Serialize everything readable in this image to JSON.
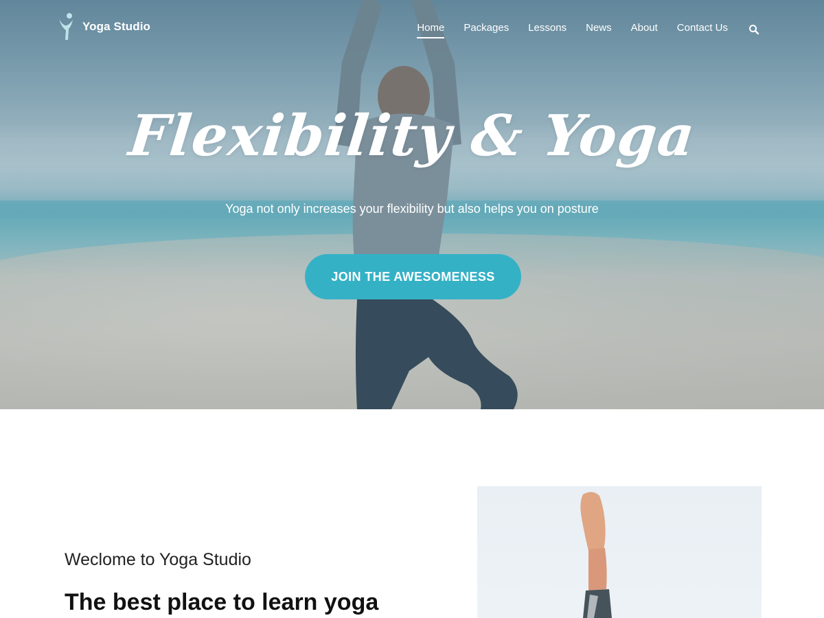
{
  "header": {
    "brand_name": "Yoga Studio",
    "logo_icon": "yoga-figure-logo",
    "nav": [
      {
        "label": "Home",
        "active": true
      },
      {
        "label": "Packages",
        "active": false
      },
      {
        "label": "Lessons",
        "active": false
      },
      {
        "label": "News",
        "active": false
      },
      {
        "label": "About",
        "active": false
      },
      {
        "label": "Contact Us",
        "active": false
      }
    ],
    "search_icon": "search-icon"
  },
  "hero": {
    "title": "Flexibility & Yoga",
    "subtitle": "Yoga not only increases your flexibility but also helps you on posture",
    "cta_label": "JOIN THE AWESOMENESS",
    "cta_color": "#35b1c6"
  },
  "welcome": {
    "eyebrow": "Weclome to Yoga Studio",
    "heading": "The best place to learn yoga"
  },
  "colors": {
    "accent": "#35b1c6",
    "logo": "#bfe3e9",
    "text": "#222222"
  }
}
